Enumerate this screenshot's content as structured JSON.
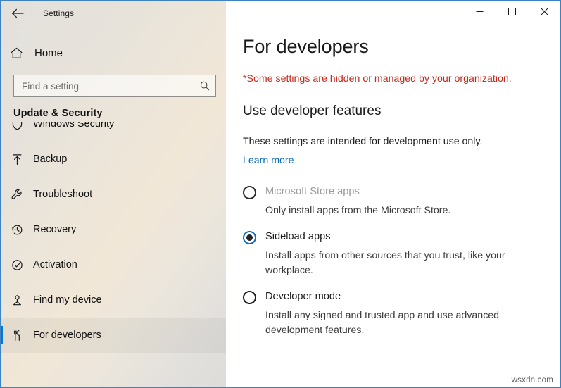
{
  "window": {
    "app_title": "Settings",
    "back_icon": "back-arrow-icon",
    "controls": {
      "minimize": "–",
      "maximize": "☐",
      "close": "✕"
    }
  },
  "sidebar": {
    "home_label": "Home",
    "home_icon": "home-icon",
    "search": {
      "placeholder": "Find a setting",
      "value": "",
      "icon": "search-icon"
    },
    "group_header": "Update & Security",
    "items": [
      {
        "label": "Windows Security",
        "icon": "shield-icon",
        "selected": false
      },
      {
        "label": "Backup",
        "icon": "backup-upload-icon",
        "selected": false
      },
      {
        "label": "Troubleshoot",
        "icon": "wrench-icon",
        "selected": false
      },
      {
        "label": "Recovery",
        "icon": "history-clock-icon",
        "selected": false
      },
      {
        "label": "Activation",
        "icon": "check-circle-icon",
        "selected": false
      },
      {
        "label": "Find my device",
        "icon": "location-pin-icon",
        "selected": false
      },
      {
        "label": "For developers",
        "icon": "developer-tools-icon",
        "selected": true
      }
    ]
  },
  "main": {
    "page_title": "For developers",
    "org_warning": "*Some settings are hidden or managed by your organization.",
    "section_title": "Use developer features",
    "section_desc": "These settings are intended for development use only.",
    "learn_more": "Learn more",
    "options": [
      {
        "label": "Microsoft Store apps",
        "desc": "Only install apps from the Microsoft Store.",
        "checked": false,
        "disabled": true
      },
      {
        "label": "Sideload apps",
        "desc": "Install apps from other sources that you trust, like your workplace.",
        "checked": true,
        "disabled": false
      },
      {
        "label": "Developer mode",
        "desc": "Install any signed and trusted app and use advanced development features.",
        "checked": false,
        "disabled": false
      }
    ]
  },
  "watermark": "wsxdn.com",
  "colors": {
    "accent": "#0078d7",
    "link": "#0b69bd",
    "warning": "#c42b1c",
    "window_border": "#3d83c4"
  }
}
